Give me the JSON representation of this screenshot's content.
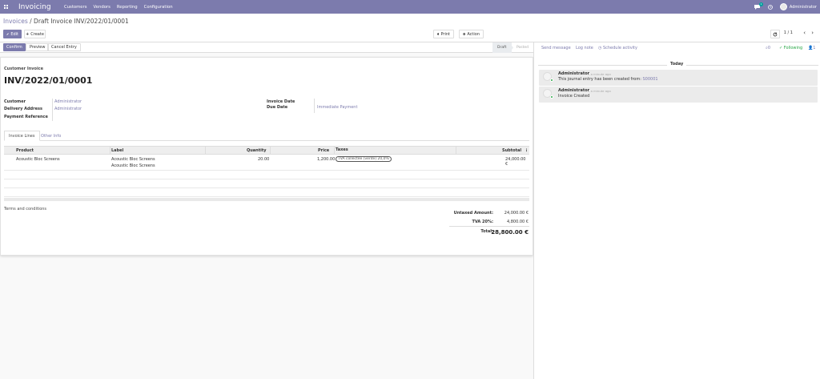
{
  "navbar": {
    "app_name": "Invoicing",
    "menu": [
      "Customers",
      "Vendors",
      "Reporting",
      "Configuration"
    ],
    "chat_badge": "1",
    "user": "Administrator"
  },
  "breadcrumb": {
    "parent": "Invoices",
    "separator": "/",
    "current": "Draft Invoice INV/2022/01/0001"
  },
  "toolbar": {
    "edit": "Edit",
    "create": "Create",
    "print": "Print",
    "action": "Action",
    "pager": "1 / 1"
  },
  "statusbar": {
    "confirm": "Confirm",
    "preview": "Preview",
    "cancel": "Cancel Entry",
    "stages": [
      "Draft",
      "Posted"
    ]
  },
  "form": {
    "type_label": "Customer Invoice",
    "number": "INV/2022/01/0001",
    "customer_label": "Customer",
    "customer": "Administrator",
    "delivery_label": "Delivery Address",
    "delivery": "Administrator",
    "payment_ref_label": "Payment Reference",
    "invoice_date_label": "Invoice Date",
    "due_date_label": "Due Date",
    "due_date": "Immediate Payment"
  },
  "tabs": [
    "Invoice Lines",
    "Other Info"
  ],
  "lines": {
    "headers": [
      "Product",
      "Label",
      "Quantity",
      "Price",
      "Taxes",
      "Subtotal"
    ],
    "rows": [
      {
        "product": "Acoustic Bloc Screens",
        "label1": "Acoustic Bloc Screens",
        "label2": "Acoustic Bloc Screens",
        "quantity": "20.00",
        "price": "1,200.00",
        "tax": "TVA collectée (vente) 20,0%",
        "subtotal": "24,000.00 €"
      }
    ]
  },
  "terms": "Terms and conditions",
  "totals": {
    "untaxed_label": "Untaxed Amount:",
    "untaxed": "24,000.00 €",
    "tva_label": "TVA 20%:",
    "tva": "4,800.00 €",
    "total_label": "Total:",
    "total": "28,800.00 €"
  },
  "chatter": {
    "send_message": "Send message",
    "log_note": "Log note",
    "schedule": "Schedule activity",
    "attachments": "0",
    "following": "Following",
    "followers": "1",
    "today": "Today",
    "messages": [
      {
        "author": "Administrator",
        "time": "- a minute ago",
        "text": "This journal entry has been created from:",
        "link": "S00001"
      },
      {
        "author": "Administrator",
        "time": "- a minute ago",
        "text": "Invoice Created",
        "link": ""
      }
    ]
  },
  "colors": {
    "brand": "#7c7bad",
    "online": "#28a745"
  }
}
